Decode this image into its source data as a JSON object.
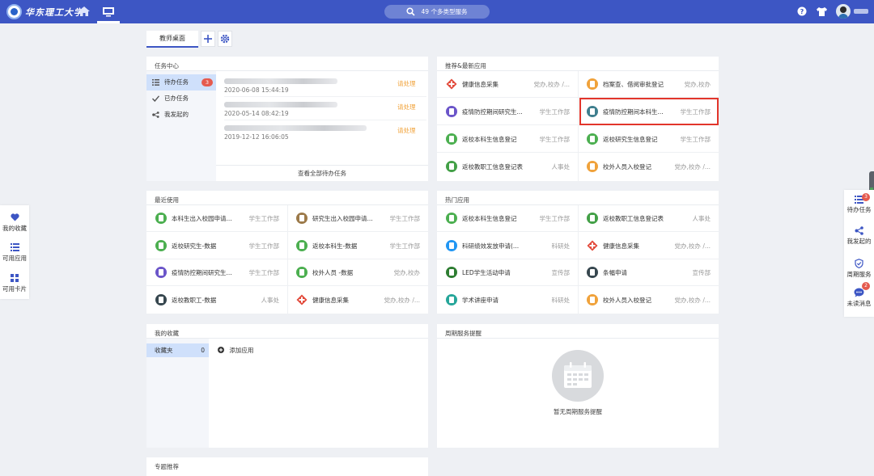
{
  "header": {
    "logo_text": "华东理工大学",
    "search_text": "49 个多类型服务"
  },
  "tabs": {
    "active": "教师桌面"
  },
  "task_center": {
    "title": "任务中心",
    "nav": [
      {
        "label": "待办任务",
        "badge": "3"
      },
      {
        "label": "已办任务"
      },
      {
        "label": "我发起的"
      }
    ],
    "rows": [
      {
        "date": "2020-06-08 15:44:19",
        "status": "请处理"
      },
      {
        "date": "2020-05-14 08:42:19",
        "status": "请处理"
      },
      {
        "date": "2019-12-12 16:06:05",
        "status": "请处理"
      }
    ],
    "view_all": "查看全部待办任务"
  },
  "recommend": {
    "title": "推荐&最新应用",
    "apps": [
      {
        "name": "健康信息采集",
        "dept": "党办,校办 /...",
        "color": "#e24a3b",
        "icon": "cross-icon"
      },
      {
        "name": "档案查、借阅审批登记",
        "dept": "党办,校办",
        "color": "#f0a23b",
        "icon": "archive-icon"
      },
      {
        "name": "疫情防控期间研究生...",
        "dept": "学生工作部",
        "color": "#6b55c9",
        "icon": "form-icon"
      },
      {
        "name": "疫情防控期间本科生...",
        "dept": "学生工作部",
        "color": "#3f7f8e",
        "icon": "form-icon"
      },
      {
        "name": "返校本科生信息登记",
        "dept": "学生工作部",
        "color": "#4caf50",
        "icon": "form-icon"
      },
      {
        "name": "返校研究生信息登记",
        "dept": "学生工作部",
        "color": "#4caf50",
        "icon": "form-icon"
      },
      {
        "name": "返校教职工信息登记表",
        "dept": "人事处",
        "color": "#43a047",
        "icon": "form-icon"
      },
      {
        "name": "校外人员入校登记",
        "dept": "党办,校办 /...",
        "color": "#f0a23b",
        "icon": "person-icon"
      }
    ]
  },
  "recent": {
    "title": "最近使用",
    "apps": [
      {
        "name": "本科生出入校园申请...",
        "dept": "学生工作部",
        "color": "#4caf50",
        "icon": "form-icon"
      },
      {
        "name": "研究生出入校园申请...",
        "dept": "学生工作部",
        "color": "#9c7a4a",
        "icon": "form-icon"
      },
      {
        "name": "返校研究生-数据",
        "dept": "学生工作部",
        "color": "#4caf50",
        "icon": "form-icon"
      },
      {
        "name": "返校本科生-数据",
        "dept": "学生工作部",
        "color": "#4caf50",
        "icon": "form-icon"
      },
      {
        "name": "疫情防控期间研究生...",
        "dept": "学生工作部",
        "color": "#6b55c9",
        "icon": "form-icon"
      },
      {
        "name": "校外人员 -数据",
        "dept": "党办,校办",
        "color": "#4caf50",
        "icon": "form-icon"
      },
      {
        "name": "返校教职工-数据",
        "dept": "人事处",
        "color": "#37474f",
        "icon": "form-icon"
      },
      {
        "name": "健康信息采集",
        "dept": "党办,校办 /...",
        "color": "#e24a3b",
        "icon": "cross-icon"
      }
    ]
  },
  "hot": {
    "title": "热门应用",
    "apps": [
      {
        "name": "返校本科生信息登记",
        "dept": "学生工作部",
        "color": "#4caf50",
        "icon": "form-icon"
      },
      {
        "name": "返校教职工信息登记表",
        "dept": "人事处",
        "color": "#43a047",
        "icon": "form-icon"
      },
      {
        "name": "科研绩效发放申请(...",
        "dept": "科研处",
        "color": "#2196f3",
        "icon": "form-icon"
      },
      {
        "name": "健康信息采集",
        "dept": "党办,校办 /...",
        "color": "#e24a3b",
        "icon": "cross-icon"
      },
      {
        "name": "LED学生活动申请",
        "dept": "宣传部",
        "color": "#2e7d32",
        "icon": "form-icon"
      },
      {
        "name": "条幅申请",
        "dept": "宣传部",
        "color": "#37474f",
        "icon": "form-icon"
      },
      {
        "name": "学术讲座申请",
        "dept": "科研处",
        "color": "#26a69a",
        "icon": "form-icon"
      },
      {
        "name": "校外人员入校登记",
        "dept": "党办,校办 /...",
        "color": "#f0a23b",
        "icon": "person-icon"
      }
    ]
  },
  "favorites": {
    "title": "我的收藏",
    "folder": "收藏夹",
    "count": "0",
    "add_label": "添加应用"
  },
  "periodic": {
    "title": "周期服务提醒",
    "empty_text": "暂无周期服务提醒"
  },
  "topics": {
    "title": "专题推荐"
  },
  "left_float": [
    {
      "label": "我的收藏",
      "icon": "heart-icon"
    },
    {
      "label": "可用应用",
      "icon": "list-icon"
    },
    {
      "label": "可用卡片",
      "icon": "grid-icon"
    }
  ],
  "right_float": [
    {
      "label": "待办任务",
      "badge": "3",
      "icon": "todo-icon"
    },
    {
      "label": "我发起的",
      "icon": "share-icon"
    },
    {
      "label": "周期服务",
      "icon": "shield-icon"
    },
    {
      "label": "未读消息",
      "badge": "2",
      "icon": "message-icon"
    }
  ],
  "colors": {
    "brand": "#3d56c4",
    "accent_orange": "#f1a33b",
    "badge_red": "#e55a4e",
    "selection": "#cfe0fb"
  }
}
